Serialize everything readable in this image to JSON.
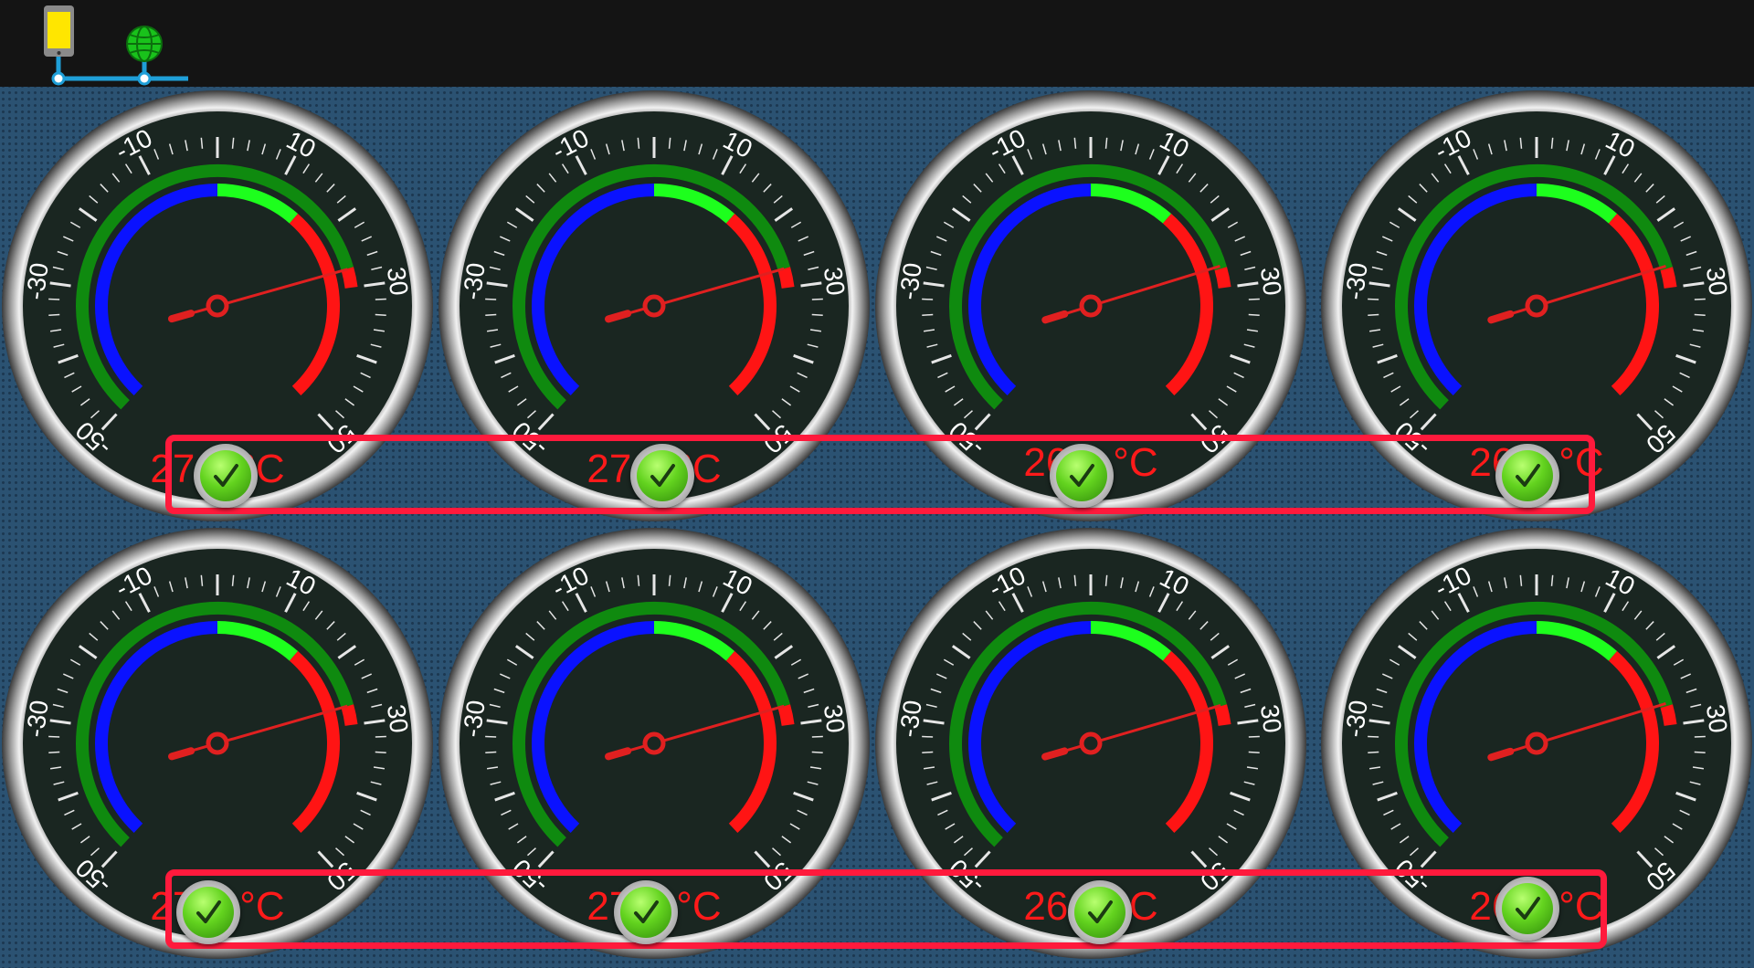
{
  "topbar": {
    "icons": [
      "phone-icon",
      "globe-icon"
    ],
    "connection_color": "#1f9fd8"
  },
  "gauges": [
    {
      "label": "27.1 °C",
      "value": 27.1,
      "status": "check-icon"
    },
    {
      "label": "27.0 °C",
      "value": 27.0,
      "status": "check-icon"
    },
    {
      "label": "26.6 °C",
      "value": 26.6,
      "status": "check-icon"
    },
    {
      "label": "26.6 °C",
      "value": 26.6,
      "status": "check-icon"
    },
    {
      "label": "27.0 °C",
      "value": 27.0,
      "status": "check-icon"
    },
    {
      "label": "27.0 °C",
      "value": 27.0,
      "status": "check-icon"
    },
    {
      "label": "26.9 °C",
      "value": 26.9,
      "status": "check-icon"
    },
    {
      "label": "26.6 °C",
      "value": 26.6,
      "status": "check-icon"
    }
  ],
  "scale": {
    "min": -50,
    "max": 50,
    "tick_labels": [
      "-50",
      "-30",
      "-10",
      "10",
      "30",
      "50"
    ],
    "zones": {
      "cold": "#0a12ff",
      "normal": "#1dff1d",
      "hot": "#ff1414",
      "outer": "#0f8a0f"
    }
  },
  "highlight_color": "#ff1a3c"
}
